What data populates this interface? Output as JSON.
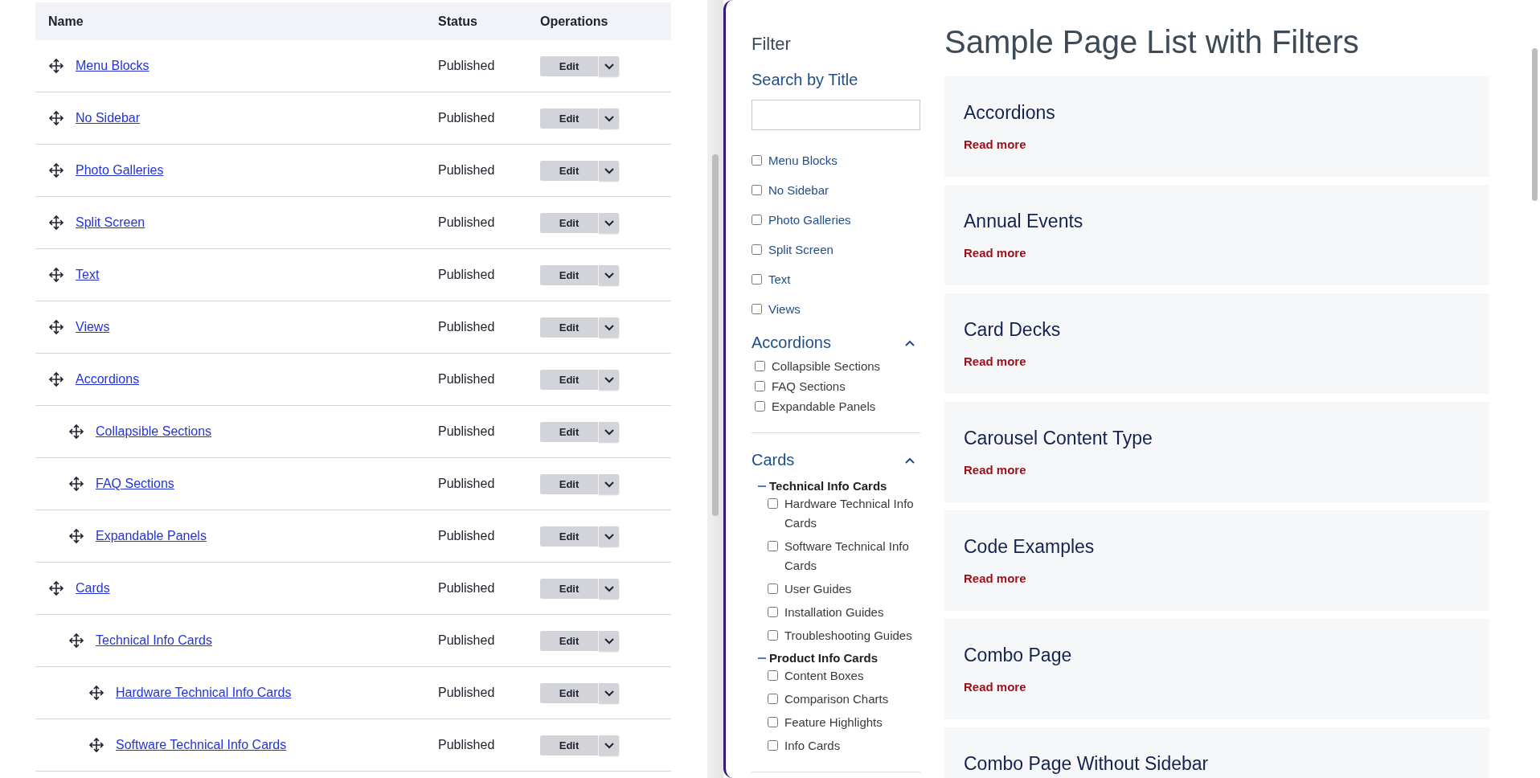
{
  "table": {
    "columns": [
      "Name",
      "Status",
      "Operations"
    ],
    "rows": [
      {
        "name": "Menu Blocks",
        "status": "Published",
        "edit": "Edit"
      },
      {
        "name": "No Sidebar",
        "status": "Published",
        "edit": "Edit"
      },
      {
        "name": "Photo Galleries",
        "status": "Published",
        "edit": "Edit"
      },
      {
        "name": "Split Screen",
        "status": "Published",
        "edit": "Edit"
      },
      {
        "name": "Text",
        "status": "Published",
        "edit": "Edit"
      },
      {
        "name": "Views",
        "status": "Published",
        "edit": "Edit"
      },
      {
        "name": "Accordions",
        "status": "Published",
        "edit": "Edit",
        "children": [
          {
            "name": "Collapsible Sections",
            "status": "Published",
            "edit": "Edit"
          },
          {
            "name": "FAQ Sections",
            "status": "Published",
            "edit": "Edit"
          },
          {
            "name": "Expandable Panels",
            "status": "Published",
            "edit": "Edit"
          }
        ]
      },
      {
        "name": "Cards",
        "status": "Published",
        "edit": "Edit",
        "children": [
          {
            "name": "Technical Info Cards",
            "status": "Published",
            "edit": "Edit",
            "children": [
              {
                "name": "Hardware Technical Info Cards",
                "status": "Published",
                "edit": "Edit"
              },
              {
                "name": "Software Technical Info Cards",
                "status": "Published",
                "edit": "Edit"
              }
            ]
          }
        ]
      }
    ]
  },
  "filter": {
    "title": "Filter",
    "search_label": "Search by Title",
    "options": [
      {
        "label": "Menu Blocks",
        "checked": false
      },
      {
        "label": "No Sidebar",
        "checked": false
      },
      {
        "label": "Photo Galleries",
        "checked": false
      },
      {
        "label": "Split Screen",
        "checked": false
      },
      {
        "label": "Text",
        "checked": false
      },
      {
        "label": "Views",
        "checked": false
      }
    ],
    "groups": [
      {
        "title": "Accordions",
        "expanded": true,
        "children": [
          {
            "label": "Collapsible Sections",
            "checked": false
          },
          {
            "label": "FAQ Sections",
            "checked": false
          },
          {
            "label": "Expandable Panels",
            "checked": false
          }
        ]
      },
      {
        "title": "Cards",
        "expanded": true,
        "children": [
          {
            "label": "Technical Info Cards",
            "expanded": true,
            "children": [
              {
                "label": "Hardware Technical Info Cards",
                "checked": false
              },
              {
                "label": "Software Technical Info Cards",
                "checked": false
              },
              {
                "label": "User Guides",
                "checked": false
              },
              {
                "label": "Installation Guides",
                "checked": false
              },
              {
                "label": "Troubleshooting Guides",
                "checked": false
              }
            ]
          },
          {
            "label": "Product Info Cards",
            "expanded": true,
            "children": [
              {
                "label": "Content Boxes",
                "checked": false
              },
              {
                "label": "Comparison Charts",
                "checked": false
              },
              {
                "label": "Feature Highlights",
                "checked": false
              },
              {
                "label": "Info Cards",
                "checked": false
              }
            ]
          }
        ]
      }
    ]
  },
  "page": {
    "title": "Sample Page List with Filters",
    "cards": [
      {
        "title": "Accordions",
        "link": "Read more"
      },
      {
        "title": "Annual Events",
        "link": "Read more"
      },
      {
        "title": "Card Decks",
        "link": "Read more"
      },
      {
        "title": "Carousel Content Type",
        "link": "Read more"
      },
      {
        "title": "Code Examples",
        "link": "Read more"
      },
      {
        "title": "Combo Page",
        "link": "Read more"
      },
      {
        "title": "Combo Page Without Sidebar"
      }
    ]
  }
}
